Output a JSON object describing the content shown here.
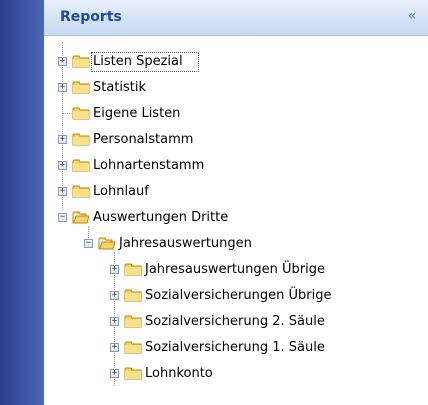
{
  "panel": {
    "title": "Reports",
    "collapse_glyph": "«"
  },
  "tree": {
    "items": [
      {
        "label": "Listen Spezial",
        "state": "collapsed",
        "icon": "folder-icon",
        "selected": true
      },
      {
        "label": "Statistik",
        "state": "collapsed",
        "icon": "folder-icon"
      },
      {
        "label": "Eigene Listen",
        "state": "leaf",
        "icon": "folder-icon"
      },
      {
        "label": "Personalstamm",
        "state": "collapsed",
        "icon": "folder-icon"
      },
      {
        "label": "Lohnartenstamm",
        "state": "collapsed",
        "icon": "folder-icon"
      },
      {
        "label": "Lohnlauf",
        "state": "collapsed",
        "icon": "folder-icon"
      },
      {
        "label": "Auswertungen Dritte",
        "state": "expanded",
        "icon": "folder-icon"
      },
      {
        "label": "Jahresauswertungen",
        "state": "expanded",
        "icon": "folder-icon"
      },
      {
        "label": "Jahresauswertungen Übrige",
        "state": "collapsed",
        "icon": "folder-icon"
      },
      {
        "label": "Sozialversicherungen Übrige",
        "state": "collapsed",
        "icon": "folder-icon"
      },
      {
        "label": "Sozialversicherung 2. Säule",
        "state": "collapsed",
        "icon": "folder-icon"
      },
      {
        "label": "Sozialversicherung 1. Säule",
        "state": "collapsed",
        "icon": "folder-icon"
      },
      {
        "label": "Lohnkonto",
        "state": "collapsed",
        "icon": "folder-icon"
      }
    ]
  },
  "colors": {
    "header_text": "#1f4b99",
    "folder_fill": "#f7d26a",
    "folder_edge": "#b8860b",
    "sidebar_strip": "#2b3f8c"
  }
}
